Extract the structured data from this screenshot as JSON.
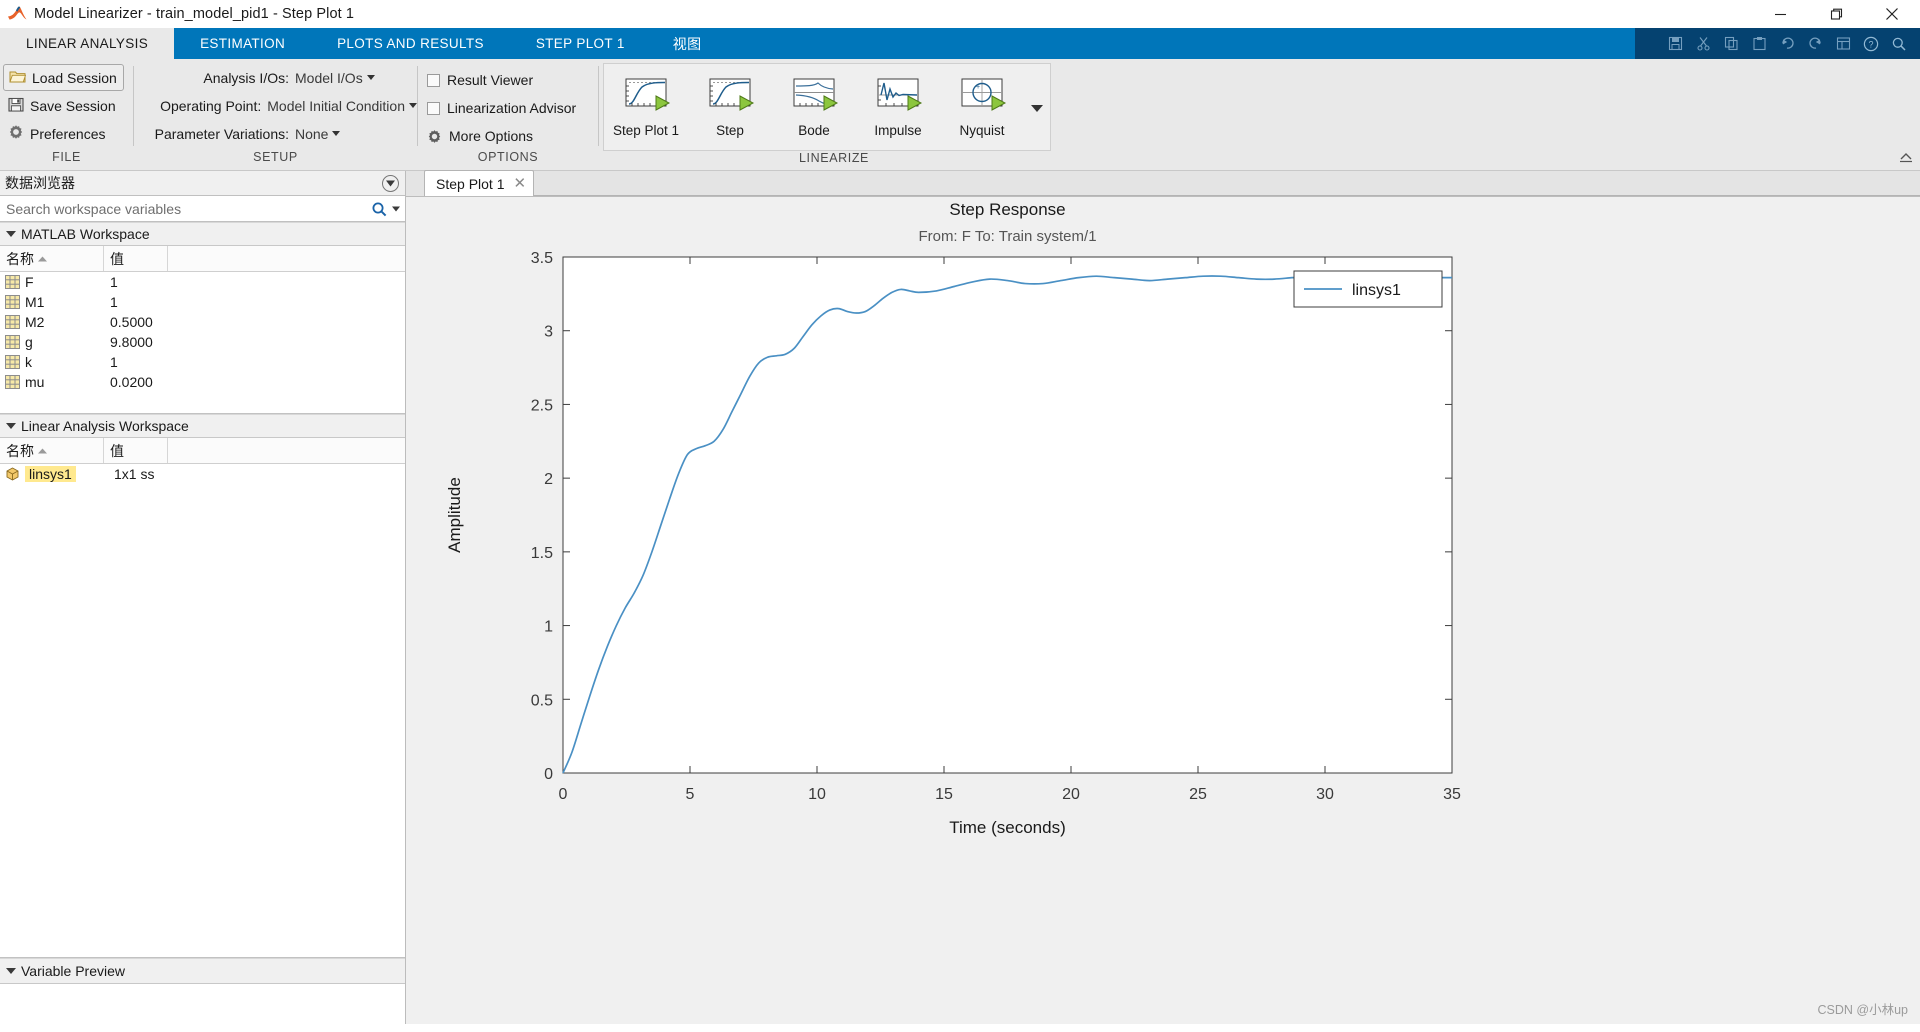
{
  "window": {
    "title": "Model Linearizer - train_model_pid1 - Step Plot 1",
    "logo_icon": "matlab-logo-icon",
    "minimize_icon": "minimize-icon",
    "restore_icon": "restore-icon",
    "close_icon": "close-icon"
  },
  "ribbon": {
    "tabs": [
      {
        "label": "LINEAR ANALYSIS",
        "active": true
      },
      {
        "label": "ESTIMATION",
        "active": false
      },
      {
        "label": "PLOTS AND RESULTS",
        "active": false
      },
      {
        "label": "STEP PLOT 1",
        "active": false
      },
      {
        "label": "视图",
        "active": false
      }
    ],
    "quick_access": [
      "save-icon",
      "cut-icon",
      "copy-icon",
      "paste-icon",
      "undo-icon",
      "redo-icon",
      "layout-icon",
      "help-icon",
      "search-icon"
    ],
    "groups": {
      "file": {
        "label": "FILE",
        "items": [
          {
            "label": "Load Session",
            "icon": "folder-open-icon",
            "boxed": true
          },
          {
            "label": "Save Session",
            "icon": "floppy-disk-icon",
            "boxed": false
          },
          {
            "label": "Preferences",
            "icon": "gear-icon",
            "boxed": false
          }
        ]
      },
      "setup": {
        "label": "SETUP",
        "rows": [
          {
            "label": "Analysis I/Os:",
            "value": "Model I/Os",
            "dropdown": true
          },
          {
            "label": "Operating Point:",
            "value": "Model Initial Condition",
            "dropdown": true
          },
          {
            "label": "Parameter Variations:",
            "value": "None",
            "dropdown": true
          }
        ]
      },
      "options": {
        "label": "OPTIONS",
        "items": [
          {
            "label": "Result Viewer",
            "icon": "checkbox-icon"
          },
          {
            "label": "Linearization Advisor",
            "icon": "checkbox-icon"
          },
          {
            "label": "More Options",
            "icon": "gear-icon"
          }
        ]
      },
      "linearize": {
        "label": "LINEARIZE",
        "buttons": [
          {
            "label": "Step Plot 1",
            "icon": "step-plot-icon"
          },
          {
            "label": "Step",
            "icon": "step-icon"
          },
          {
            "label": "Bode",
            "icon": "bode-icon"
          },
          {
            "label": "Impulse",
            "icon": "impulse-icon"
          },
          {
            "label": "Nyquist",
            "icon": "nyquist-icon"
          }
        ],
        "more_icon": "chevron-down-icon"
      },
      "collapse_icon": "collapse-ribbon-icon"
    }
  },
  "browser": {
    "title": "数据浏览器",
    "options_icon": "browser-options-icon",
    "search": {
      "placeholder": "Search workspace variables",
      "value": "",
      "icon": "search-icon",
      "caret_icon": "chevron-down-icon"
    },
    "matlab_workspace": {
      "title": "MATLAB Workspace",
      "columns": [
        "名称",
        "值"
      ],
      "sort_icon": "sort-ascending-icon",
      "rows": [
        {
          "name": "F",
          "value": "1",
          "icon": "matrix-icon"
        },
        {
          "name": "M1",
          "value": "1",
          "icon": "matrix-icon"
        },
        {
          "name": "M2",
          "value": "0.5000",
          "icon": "matrix-icon"
        },
        {
          "name": "g",
          "value": "9.8000",
          "icon": "matrix-icon"
        },
        {
          "name": "k",
          "value": "1",
          "icon": "matrix-icon"
        },
        {
          "name": "mu",
          "value": "0.0200",
          "icon": "matrix-icon"
        }
      ]
    },
    "linear_analysis_workspace": {
      "title": "Linear Analysis Workspace",
      "columns": [
        "名称",
        "值"
      ],
      "sort_icon": "sort-ascending-icon",
      "rows": [
        {
          "name": "linsys1",
          "value": "1x1 ss",
          "icon": "ss-model-icon",
          "highlighted": true
        }
      ]
    },
    "variable_preview": {
      "title": "Variable Preview"
    }
  },
  "document": {
    "tab": {
      "label": "Step Plot 1",
      "close_icon": "close-icon"
    }
  },
  "watermark": "CSDN @小林up",
  "chart_data": {
    "type": "line",
    "title": "Step Response",
    "subtitle": "From: F  To: Train system/1",
    "xlabel": "Time (seconds)",
    "ylabel": "Amplitude",
    "xlim": [
      0,
      35
    ],
    "ylim": [
      0,
      3.5
    ],
    "xticks": [
      0,
      5,
      10,
      15,
      20,
      25,
      30,
      35
    ],
    "yticks": [
      0,
      0.5,
      1,
      1.5,
      2,
      2.5,
      3,
      3.5
    ],
    "ytick_labels": [
      "0",
      "0.5",
      "1",
      "1.5",
      "2",
      "2.5",
      "3",
      "3.5"
    ],
    "grid": false,
    "legend": {
      "entries": [
        "linsys1"
      ],
      "position": "top-right"
    },
    "line_color": "#4a90c4",
    "series": [
      {
        "name": "linsys1",
        "x": [
          0,
          0.35,
          0.7,
          1.05,
          1.4,
          1.75,
          2.1,
          2.45,
          2.8,
          3.15,
          3.5,
          3.85,
          4.2,
          4.55,
          4.9,
          5.25,
          5.6,
          5.95,
          6.3,
          6.65,
          7.0,
          7.35,
          7.7,
          8.05,
          8.4,
          8.75,
          9.1,
          9.45,
          9.8,
          10.15,
          10.5,
          10.85,
          11.2,
          11.55,
          11.9,
          12.25,
          12.6,
          12.95,
          13.3,
          13.65,
          14.0,
          14.7,
          15.4,
          16.1,
          16.8,
          17.5,
          18.2,
          18.9,
          19.6,
          20.3,
          21.0,
          21.7,
          22.4,
          23.1,
          23.8,
          24.5,
          25.2,
          25.9,
          26.6,
          27.3,
          28.0,
          28.7,
          29.4,
          30.1,
          30.8,
          31.5,
          32.2,
          32.9,
          33.6,
          34.3,
          35.0
        ],
        "y": [
          0.0,
          0.14,
          0.33,
          0.52,
          0.7,
          0.86,
          1.0,
          1.12,
          1.22,
          1.34,
          1.5,
          1.68,
          1.86,
          2.03,
          2.16,
          2.2,
          2.22,
          2.25,
          2.33,
          2.45,
          2.57,
          2.69,
          2.78,
          2.82,
          2.83,
          2.84,
          2.88,
          2.96,
          3.04,
          3.1,
          3.14,
          3.15,
          3.13,
          3.12,
          3.13,
          3.17,
          3.22,
          3.26,
          3.28,
          3.27,
          3.26,
          3.27,
          3.3,
          3.33,
          3.35,
          3.34,
          3.32,
          3.32,
          3.34,
          3.36,
          3.37,
          3.36,
          3.35,
          3.34,
          3.35,
          3.36,
          3.37,
          3.37,
          3.36,
          3.35,
          3.35,
          3.36,
          3.37,
          3.37,
          3.36,
          3.36,
          3.36,
          3.36,
          3.36,
          3.36,
          3.36
        ]
      }
    ]
  }
}
